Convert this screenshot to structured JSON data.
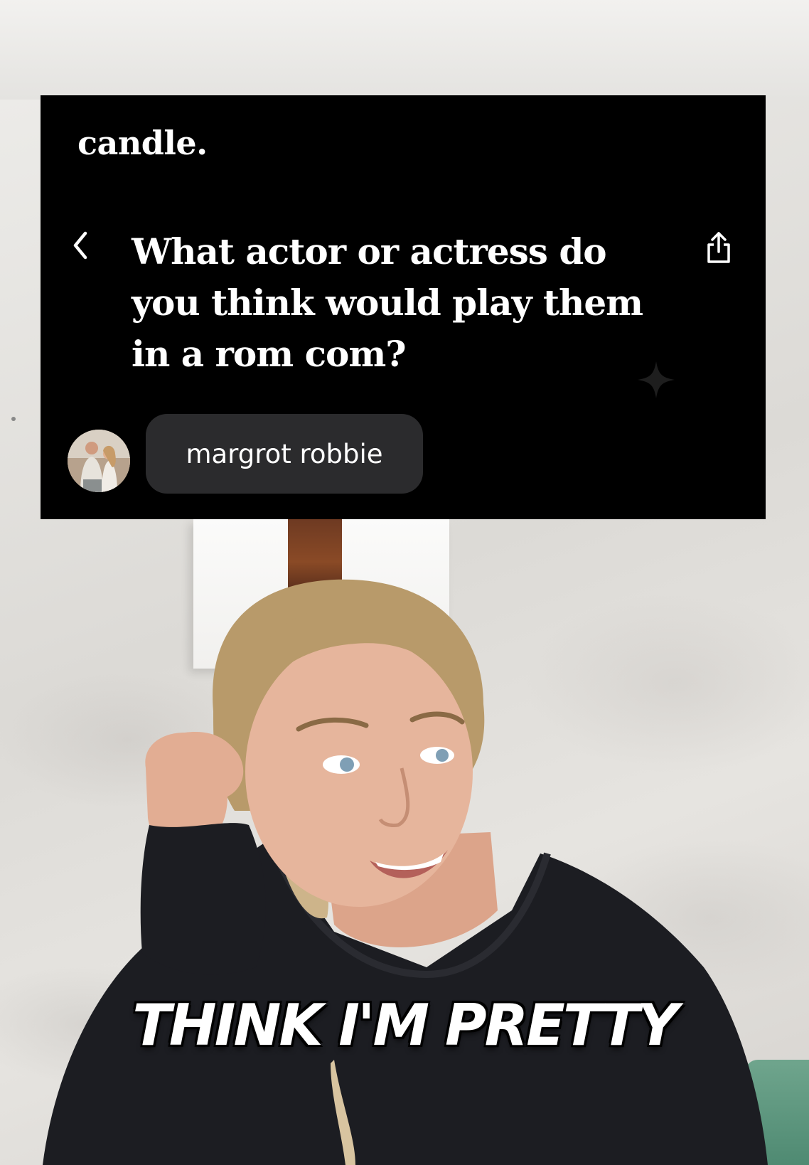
{
  "card": {
    "brand": "candle.",
    "question": "What actor or actress do you think would play them in a rom com?",
    "answer": "margrot robbie",
    "back_icon": "chevron-left-icon",
    "share_icon": "share-icon",
    "sparkle_icon": "sparkle-icon"
  },
  "caption": "THINK I'M PRETTY",
  "colors": {
    "card_bg": "#000000",
    "bubble_bg": "#2b2b2d",
    "text": "#ffffff",
    "hoodie": "#1c1d22",
    "hair": "#b89a6a"
  }
}
